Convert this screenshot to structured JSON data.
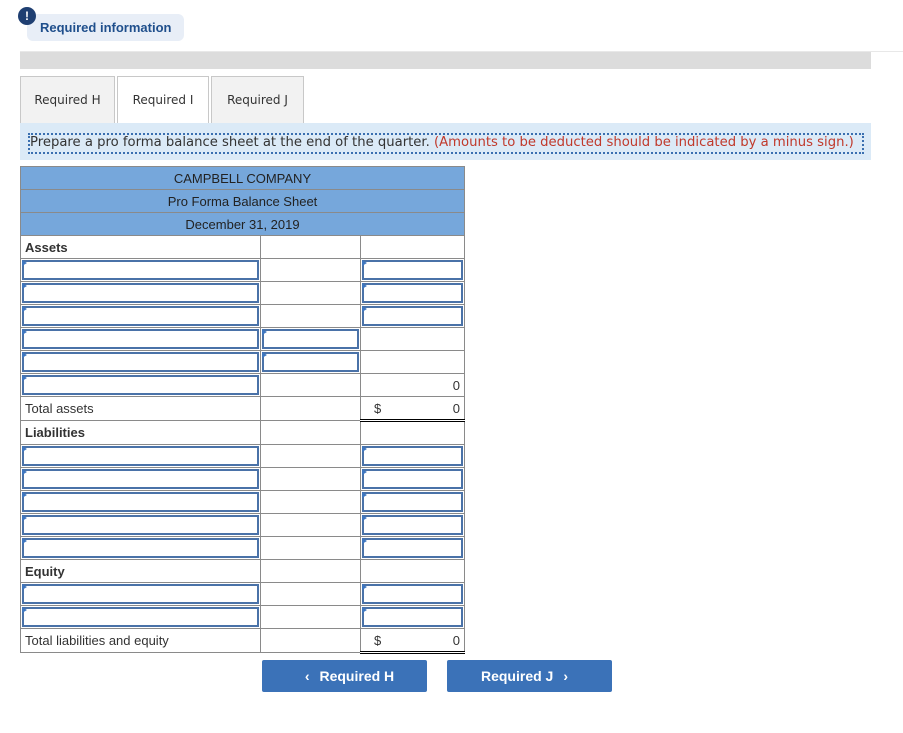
{
  "header": {
    "alert_icon": "!",
    "required_info_label": "Required information"
  },
  "tabs": [
    {
      "label": "Required H",
      "active": false
    },
    {
      "label": "Required I",
      "active": true
    },
    {
      "label": "Required J",
      "active": false
    }
  ],
  "instruction": {
    "text": "Prepare a pro forma balance sheet at the end of the quarter.",
    "note": "(Amounts to be deducted should be indicated by a minus sign.)"
  },
  "balance_sheet": {
    "company": "CAMPBELL COMPANY",
    "title": "Pro Forma Balance Sheet",
    "date": "December 31, 2019",
    "assets_label": "Assets",
    "assets_subtotal": "0",
    "total_assets_label": "Total assets",
    "total_assets_currency": "$",
    "total_assets_value": "0",
    "liabilities_label": "Liabilities",
    "equity_label": "Equity",
    "total_le_label": "Total liabilities and equity",
    "total_le_currency": "$",
    "total_le_value": "0"
  },
  "nav": {
    "prev_label": "Required H",
    "prev_icon": "‹",
    "next_label": "Required J",
    "next_icon": "›"
  }
}
